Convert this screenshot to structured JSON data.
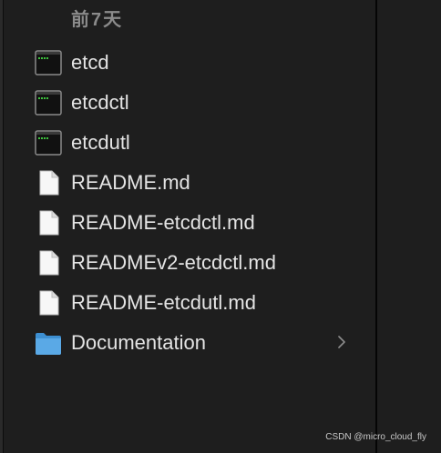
{
  "finder": {
    "section_header": "前7天",
    "items": [
      {
        "name": "etcd",
        "kind": "exec"
      },
      {
        "name": "etcdctl",
        "kind": "exec"
      },
      {
        "name": "etcdutl",
        "kind": "exec"
      },
      {
        "name": "README.md",
        "kind": "doc"
      },
      {
        "name": "README-etcdctl.md",
        "kind": "doc"
      },
      {
        "name": "READMEv2-etcdctl.md",
        "kind": "doc"
      },
      {
        "name": "README-etcdutl.md",
        "kind": "doc"
      },
      {
        "name": "Documentation",
        "kind": "folder"
      }
    ]
  },
  "icons": {
    "exec": "terminal-exec-icon",
    "doc": "document-icon",
    "folder": "folder-icon",
    "chevron": "chevron-right-icon"
  },
  "colors": {
    "background": "#1e1e1e",
    "text": "#e4e4e4",
    "header_text": "#8b8b8b",
    "folder_blue": "#5aa9e6",
    "exec_green": "#3ec23e"
  },
  "watermark": "CSDN @micro_cloud_fly"
}
